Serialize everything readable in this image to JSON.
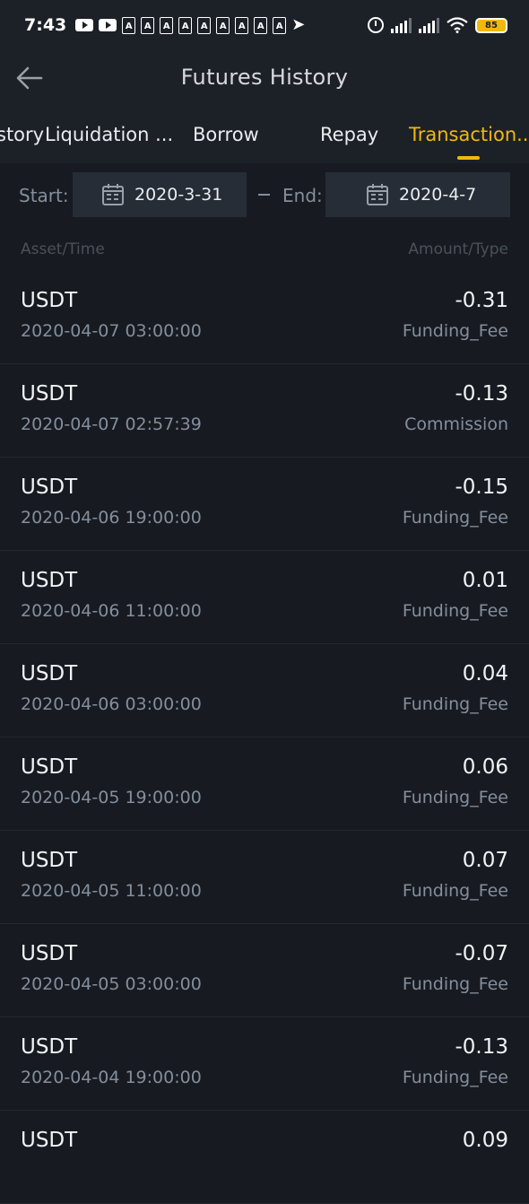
{
  "status_bar": {
    "time": "7:43",
    "battery": "85"
  },
  "header": {
    "title": "Futures History"
  },
  "tabs": [
    {
      "label": "story"
    },
    {
      "label": "Liquidation ..."
    },
    {
      "label": "Borrow"
    },
    {
      "label": "Repay"
    },
    {
      "label": "Transaction..."
    }
  ],
  "filter": {
    "start_label": "Start:",
    "start_date": "2020-3-31",
    "end_label": "End:",
    "end_date": "2020-4-7"
  },
  "columns": {
    "left": "Asset/Time",
    "right": "Amount/Type"
  },
  "transactions": [
    {
      "asset": "USDT",
      "time": "2020-04-07 03:00:00",
      "amount": "-0.31",
      "type": "Funding_Fee"
    },
    {
      "asset": "USDT",
      "time": "2020-04-07 02:57:39",
      "amount": "-0.13",
      "type": "Commission"
    },
    {
      "asset": "USDT",
      "time": "2020-04-06 19:00:00",
      "amount": "-0.15",
      "type": "Funding_Fee"
    },
    {
      "asset": "USDT",
      "time": "2020-04-06 11:00:00",
      "amount": "0.01",
      "type": "Funding_Fee"
    },
    {
      "asset": "USDT",
      "time": "2020-04-06 03:00:00",
      "amount": "0.04",
      "type": "Funding_Fee"
    },
    {
      "asset": "USDT",
      "time": "2020-04-05 19:00:00",
      "amount": "0.06",
      "type": "Funding_Fee"
    },
    {
      "asset": "USDT",
      "time": "2020-04-05 11:00:00",
      "amount": "0.07",
      "type": "Funding_Fee"
    },
    {
      "asset": "USDT",
      "time": "2020-04-05 03:00:00",
      "amount": "-0.07",
      "type": "Funding_Fee"
    },
    {
      "asset": "USDT",
      "time": "2020-04-04 19:00:00",
      "amount": "-0.13",
      "type": "Funding_Fee"
    },
    {
      "asset": "USDT",
      "time": "",
      "amount": "0.09",
      "type": ""
    }
  ]
}
